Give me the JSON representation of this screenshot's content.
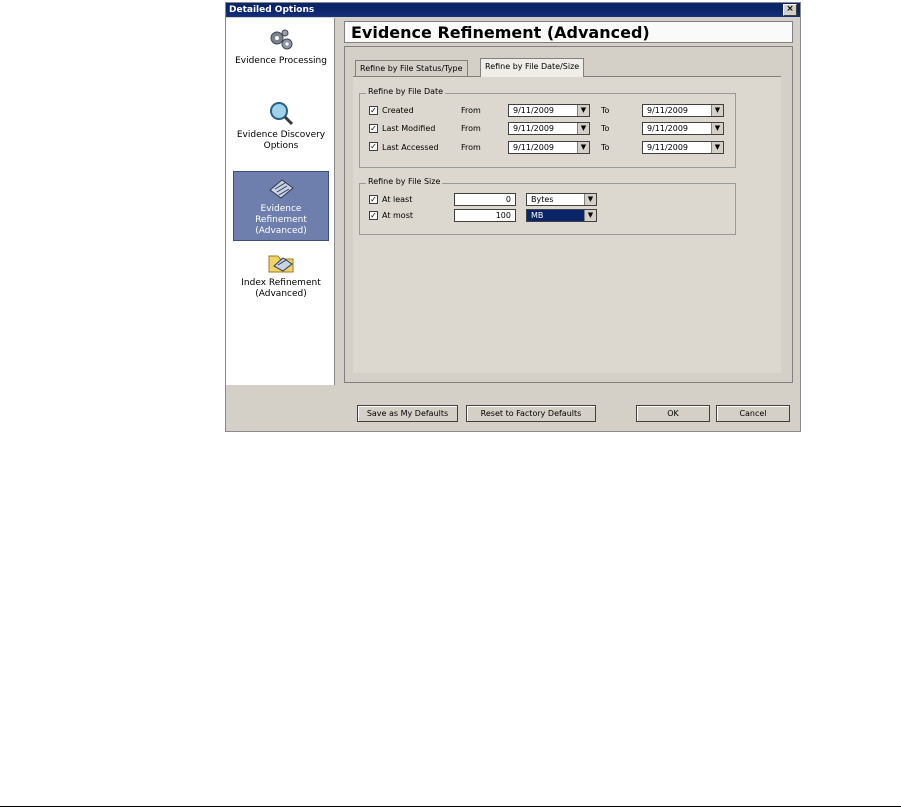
{
  "window": {
    "title": "Detailed Options",
    "close_glyph": "×"
  },
  "sidebar": {
    "items": [
      {
        "label": "Evidence Processing",
        "icon": "gears-icon"
      },
      {
        "label": "Evidence Discovery Options",
        "icon": "magnifier-icon"
      },
      {
        "label": "Evidence Refinement (Advanced)",
        "icon": "evidence-refinement-icon",
        "selected": true
      },
      {
        "label": "Index Refinement (Advanced)",
        "icon": "index-refinement-icon"
      }
    ]
  },
  "page_title": "Evidence Refinement (Advanced)",
  "tabs": [
    {
      "label": "Refine by File Status/Type",
      "active": false
    },
    {
      "label": "Refine by File Date/Size",
      "active": true
    }
  ],
  "date_group": {
    "label": "Refine by File Date",
    "from_label": "From",
    "to_label": "To",
    "rows": [
      {
        "label": "Created",
        "checked": true,
        "from": "9/11/2009",
        "to": "9/11/2009"
      },
      {
        "label": "Last Modified",
        "checked": true,
        "from": "9/11/2009",
        "to": "9/11/2009"
      },
      {
        "label": "Last Accessed",
        "checked": true,
        "from": "9/11/2009",
        "to": "9/11/2009"
      }
    ]
  },
  "size_group": {
    "label": "Refine by File Size",
    "rows": [
      {
        "label": "At least",
        "checked": true,
        "value": "0",
        "unit": "Bytes"
      },
      {
        "label": "At most",
        "checked": true,
        "value": "100",
        "unit": "MB"
      }
    ]
  },
  "buttons": {
    "save_defaults": "Save as My Defaults",
    "reset_defaults": "Reset to Factory Defaults",
    "ok": "OK",
    "cancel": "Cancel"
  },
  "colors": {
    "titlebar": "#0a246a",
    "selected_item": "#6e7fae",
    "dialog_face": "#d4d0c8"
  }
}
